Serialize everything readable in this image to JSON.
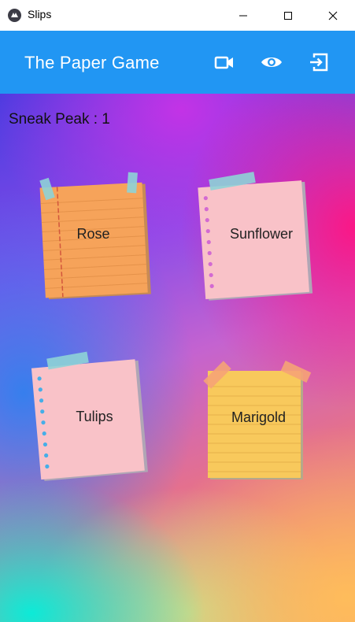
{
  "window": {
    "title": "Slips",
    "icon": "kivy-logo-icon",
    "controls": [
      "minimize-icon",
      "maximize-icon",
      "close-icon"
    ]
  },
  "appbar": {
    "title": "The Paper Game",
    "background": "#2196f3",
    "actions": [
      {
        "name": "video-camera-icon"
      },
      {
        "name": "eye-icon"
      },
      {
        "name": "exit-icon"
      }
    ]
  },
  "status": {
    "sneak_peek": "Sneak Peak : 1"
  },
  "slips": [
    {
      "label": "Rose",
      "style": "orange-lined-note",
      "color": "#f6a35a"
    },
    {
      "label": "Sunflower",
      "style": "pink-spiral-note",
      "color": "#f9c2c8"
    },
    {
      "label": "Tulips",
      "style": "pink-spiral-note",
      "color": "#f9c2c8"
    },
    {
      "label": "Marigold",
      "style": "yellow-lined-note",
      "color": "#f8c95c"
    }
  ]
}
